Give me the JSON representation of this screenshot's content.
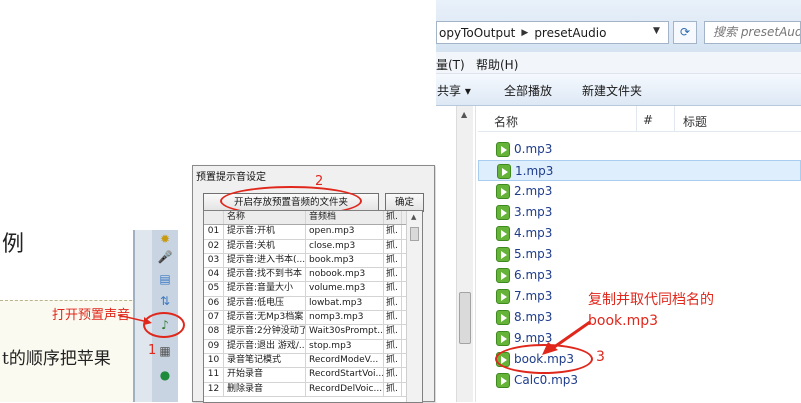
{
  "document": {
    "heading_fragment": "例",
    "body_fragment": "t的顺序把苹果"
  },
  "annotations": {
    "one_label": "打开预置声音",
    "one_number": "1",
    "two_number": "2",
    "three_text_line1": "复制并取代同档名的",
    "three_text_line2": "book.mp3",
    "three_number": "3",
    "accent_color": "#e0271c"
  },
  "dialog": {
    "title": "预置提示音设定",
    "open_folder_button": "开启存放预置音频的文件夹",
    "ok_button": "确定",
    "columns": [
      "",
      "名称",
      "音频档",
      "抓."
    ],
    "rows": [
      [
        "01",
        "提示音:开机",
        "open.mp3",
        "抓."
      ],
      [
        "02",
        "提示音:关机",
        "close.mp3",
        "抓."
      ],
      [
        "03",
        "提示音:进入书本(...",
        "book.mp3",
        "抓."
      ],
      [
        "04",
        "提示音:找不到书本",
        "nobook.mp3",
        "抓."
      ],
      [
        "05",
        "提示音:音量大小",
        "volume.mp3",
        "抓."
      ],
      [
        "06",
        "提示音:低电压",
        "lowbat.mp3",
        "抓."
      ],
      [
        "07",
        "提示音:无Mp3档案",
        "nomp3.mp3",
        "抓."
      ],
      [
        "08",
        "提示音:2分钟没动了",
        "Wait30sPrompt...",
        "抓."
      ],
      [
        "09",
        "提示音:退出 游戏/...",
        "stop.mp3",
        "抓."
      ],
      [
        "10",
        "录音笔记模式",
        "RecordModeV...",
        "抓."
      ],
      [
        "11",
        "开始录音",
        "RecordStartVoi...",
        "抓."
      ],
      [
        "12",
        "删除录音",
        "RecordDelVoic...",
        "抓."
      ]
    ]
  },
  "explorer": {
    "breadcrumb": [
      "opyToOutput",
      "presetAudio"
    ],
    "search_placeholder": "搜索 presetAudio",
    "menu": {
      "edit_fragment": "量(T)",
      "help": "帮助(H)"
    },
    "commands": {
      "share": "共享 ▾",
      "play_all": "全部播放",
      "new_folder": "新建文件夹"
    },
    "columns": {
      "name": "名称",
      "number": "#",
      "title": "标题"
    },
    "files": [
      "0.mp3",
      "1.mp3",
      "2.mp3",
      "3.mp3",
      "4.mp3",
      "5.mp3",
      "6.mp3",
      "7.mp3",
      "8.mp3",
      "9.mp3",
      "book.mp3",
      "Calc0.mp3"
    ],
    "selected_file_index": 1
  }
}
